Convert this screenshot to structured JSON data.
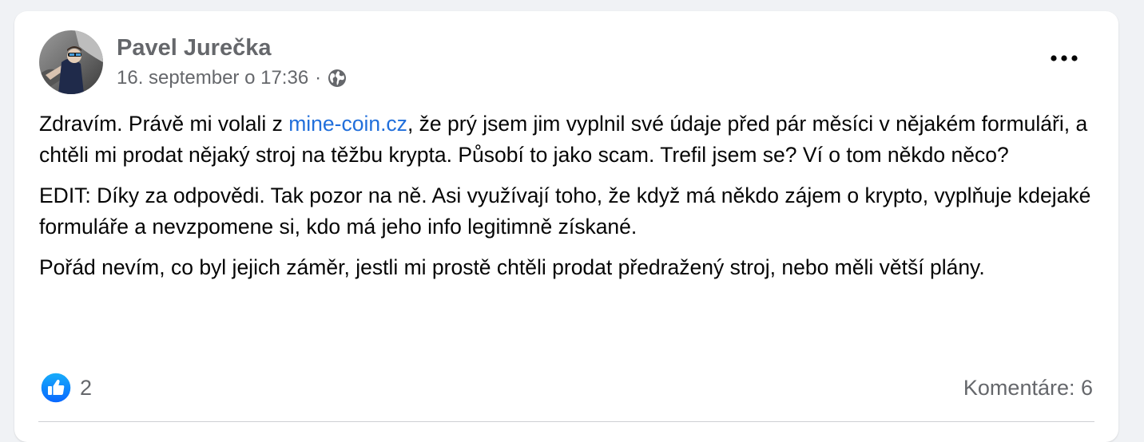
{
  "post": {
    "author": "Pavel Jurečka",
    "date": "16. september o 17:36",
    "separator": "·",
    "privacy_icon": "globe-icon",
    "more_icon": "more-horizontal-icon",
    "paragraph_1": {
      "before_link": "Zdravím. Právě mi volali z ",
      "link_text": "mine-coin.cz",
      "after_link": ", že prý jsem jim vyplnil své údaje před pár měsíci v nějakém formuláři, a chtěli mi prodat nějaký stroj na těžbu krypta. Působí to jako scam. Trefil jsem se? Ví o tom někdo něco?"
    },
    "paragraph_2": "EDIT: Díky za odpovědi. Tak pozor na ně. Asi využívají toho, že když má někdo zájem o krypto, vyplňuje kdejaké formuláře a nevzpomene si, kdo má jeho info legitimně získané.",
    "paragraph_3": "Pořád nevím, co byl jejich záměr, jestli mi prostě chtěli prodat předražený stroj, nebo měli větší plány.",
    "reactions": {
      "icon": "like-icon",
      "count": "2"
    },
    "comments_label": "Komentáre: 6"
  },
  "colors": {
    "link": "#216fdb",
    "like_blue": "#1877f2",
    "secondary_text": "#65676b"
  }
}
